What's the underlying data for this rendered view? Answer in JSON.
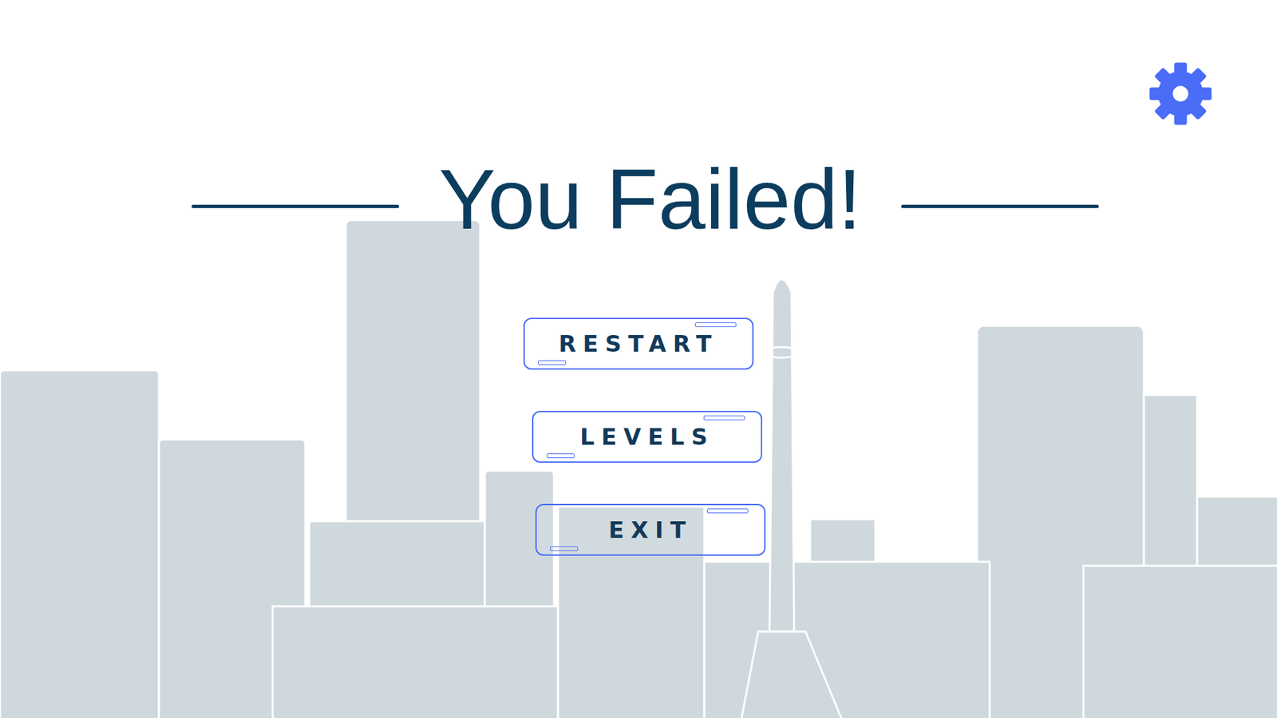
{
  "screen": {
    "title": "You Failed!"
  },
  "buttons": [
    {
      "label": "RESTART"
    },
    {
      "label": "LEVELS"
    },
    {
      "label": "EXIT"
    }
  ],
  "settings": {
    "icon": "gear"
  }
}
